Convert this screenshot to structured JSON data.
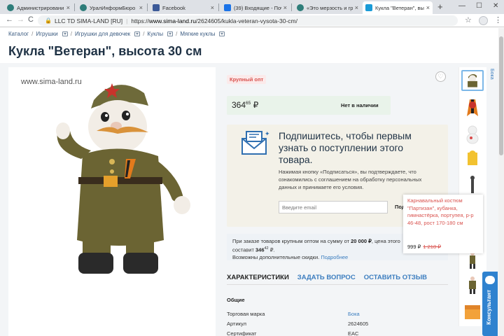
{
  "browser": {
    "tabs": [
      {
        "title": "Администрировани",
        "favicon_color": "#2e7d7a",
        "active": false
      },
      {
        "title": "УралИнформБюро И",
        "favicon_color": "#2e7d7a",
        "active": false
      },
      {
        "title": "Facebook",
        "favicon_color": "#3b5998",
        "active": false
      },
      {
        "title": "(39) Входящие - Поч",
        "favicon_color": "#1a73e8",
        "active": false
      },
      {
        "title": "«Это мерзость и гря",
        "favicon_color": "#2e7d7a",
        "active": false
      },
      {
        "title": "Кукла \"Ветеран\", высо",
        "favicon_color": "#1a9bd7",
        "active": true
      }
    ],
    "new_tab": "+",
    "minimize": "—",
    "maximize": "☐",
    "close": "✕",
    "back": "←",
    "forward": "→",
    "reload": "C",
    "cert_owner": "LLC TD SIMA-LAND [RU]",
    "url_prefix": "https://",
    "url_host": "www.sima-land.ru",
    "url_path": "/2624605/kukla-veteran-vysota-30-cm/",
    "star": "☆",
    "menu": "⋮"
  },
  "breadcrumb": [
    "Каталог",
    "Игрушки",
    "Игрушки для девочек",
    "Куклы",
    "Мягкие куклы"
  ],
  "product": {
    "title": "Кукла \"Ветеран\", высота 30 см",
    "watermark": "www.sima-land.ru",
    "badge": "Крупный опт",
    "price_int": "364",
    "price_dec": "65",
    "currency": "₽",
    "stock": "Нет в наличии",
    "heart": "♡"
  },
  "subscribe": {
    "title": "Подпишитесь, чтобы первым узнать о поступлении этого товара.",
    "note": "Нажимая кнопку «Подписаться», вы подтверждаете, что ознакомились с соглашением на обработку персональных данных и принимаете его условия.",
    "email_placeholder": "Введите email",
    "button": "Подписаться"
  },
  "wholesale": {
    "text_a": "При заказе товаров крупным оптом на сумму от ",
    "amount": "20 000 ₽",
    "text_b": ", цена этого",
    "line2_a": "составит ",
    "price2": "346",
    "price2_dec": "42",
    "price2_cur": " ₽.",
    "line3": "Возможны дополнительные скидки. ",
    "more": "Подробнее"
  },
  "tabs": [
    "ХАРАКТЕРИСТИКИ",
    "ЗАДАТЬ ВОПРОС",
    "ОСТАВИТЬ ОТЗЫВ"
  ],
  "specs": {
    "group": "Общие",
    "rows": [
      {
        "k": "Торговая марка",
        "v": "Бока",
        "link": true
      },
      {
        "k": "Артикул",
        "v": "2624605",
        "link": false
      },
      {
        "k": "Сертификат",
        "v": "EAC",
        "link": false
      }
    ]
  },
  "side": {
    "brand": "Бока",
    "tooltip_desc": "Карнавальный костюм \"Партизан\", кубанка, гимнастёрка, портупея, р-р 46-48, рост 170-180 см",
    "tooltip_price": "999 ₽",
    "tooltip_old": "1 218 ₽",
    "consult": "Консультант"
  }
}
